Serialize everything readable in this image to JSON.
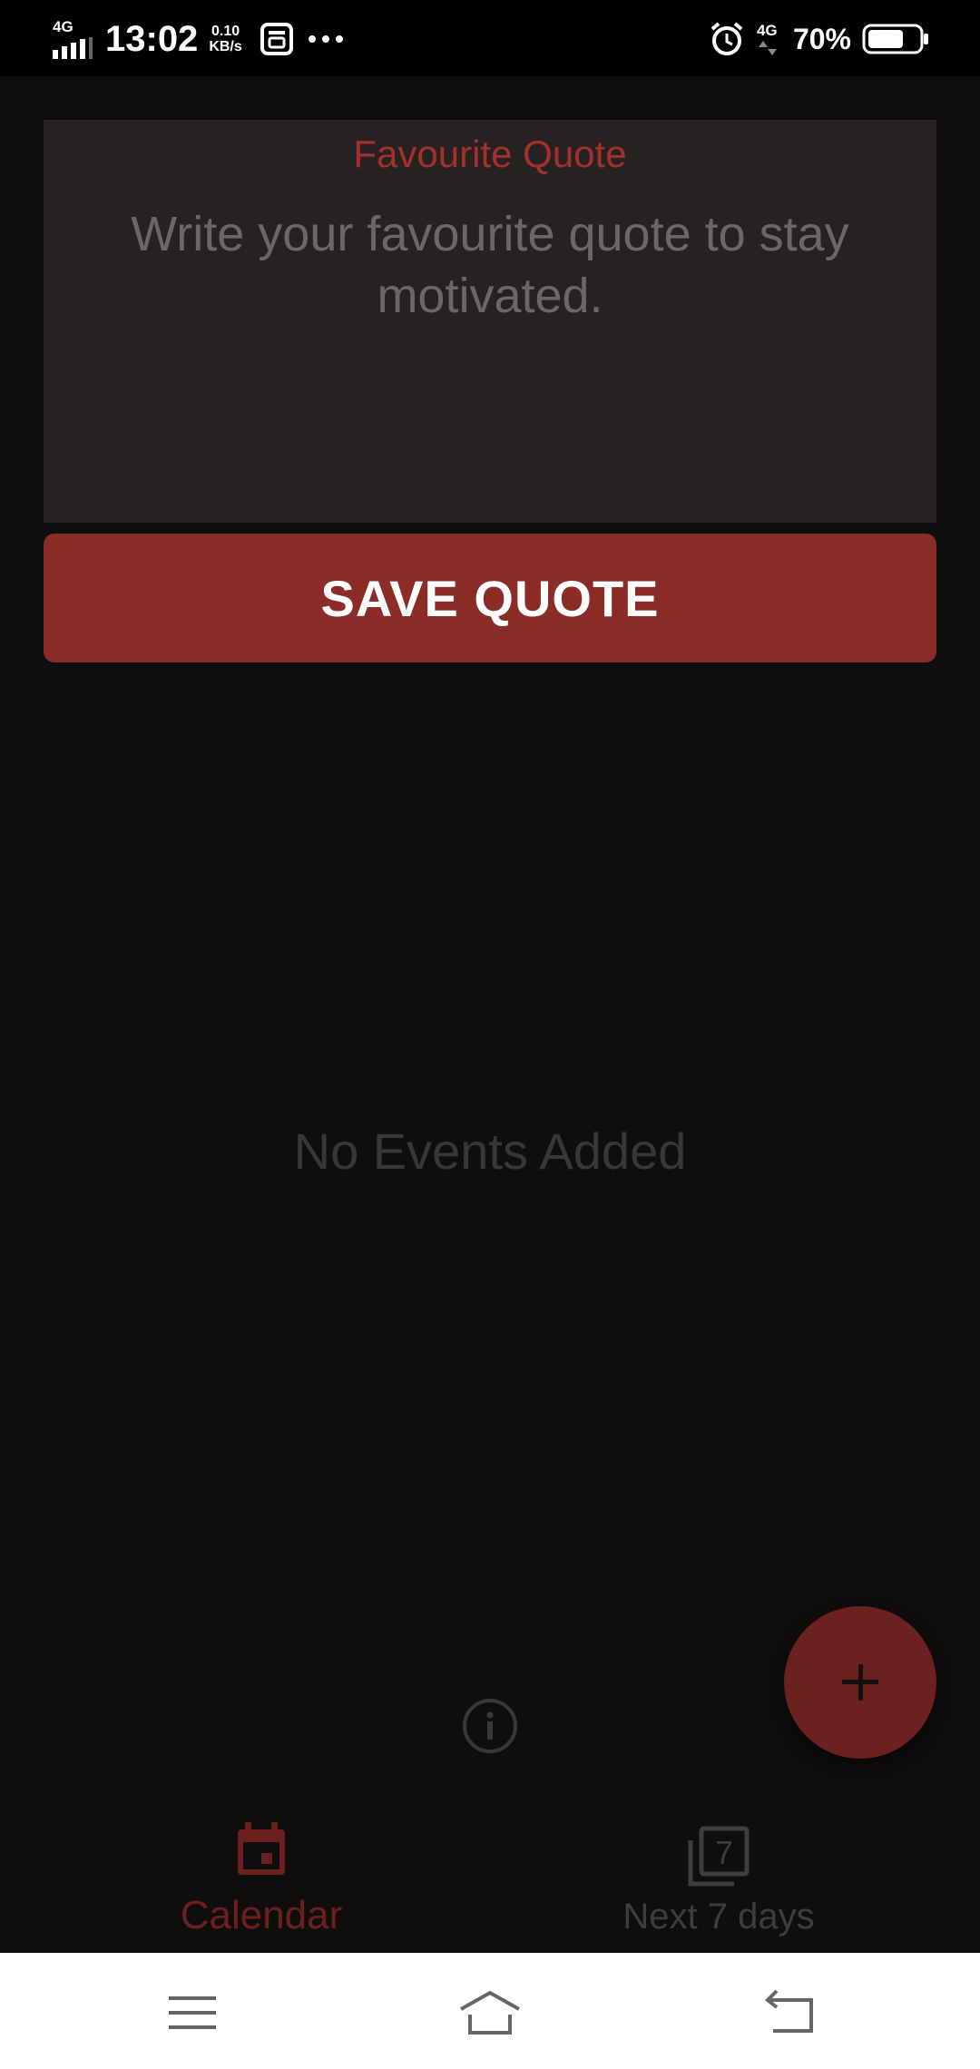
{
  "status_bar": {
    "network_left": "4G",
    "time": "13:02",
    "speed_value": "0.10",
    "speed_unit": "KB/s",
    "network_right": "4G",
    "battery_percent": "70%",
    "battery_level": 0.7
  },
  "quote": {
    "label": "Favourite Quote",
    "placeholder": "Write your favourite quote to stay motivated.",
    "value": ""
  },
  "save_button": {
    "label": "SAVE QUOTE"
  },
  "events": {
    "empty_message": "No Events Added"
  },
  "fab": {
    "icon": "plus-icon"
  },
  "bottom_nav": {
    "items": [
      {
        "label": "Calendar",
        "icon": "calendar-icon",
        "active": true
      },
      {
        "label": "Next 7 days",
        "icon": "next-7-days-icon",
        "badge": "7",
        "active": false
      }
    ]
  },
  "colors": {
    "accent": "#a5302b",
    "button": "#8b2c27",
    "background": "#0f0e0d",
    "card": "#252221"
  }
}
